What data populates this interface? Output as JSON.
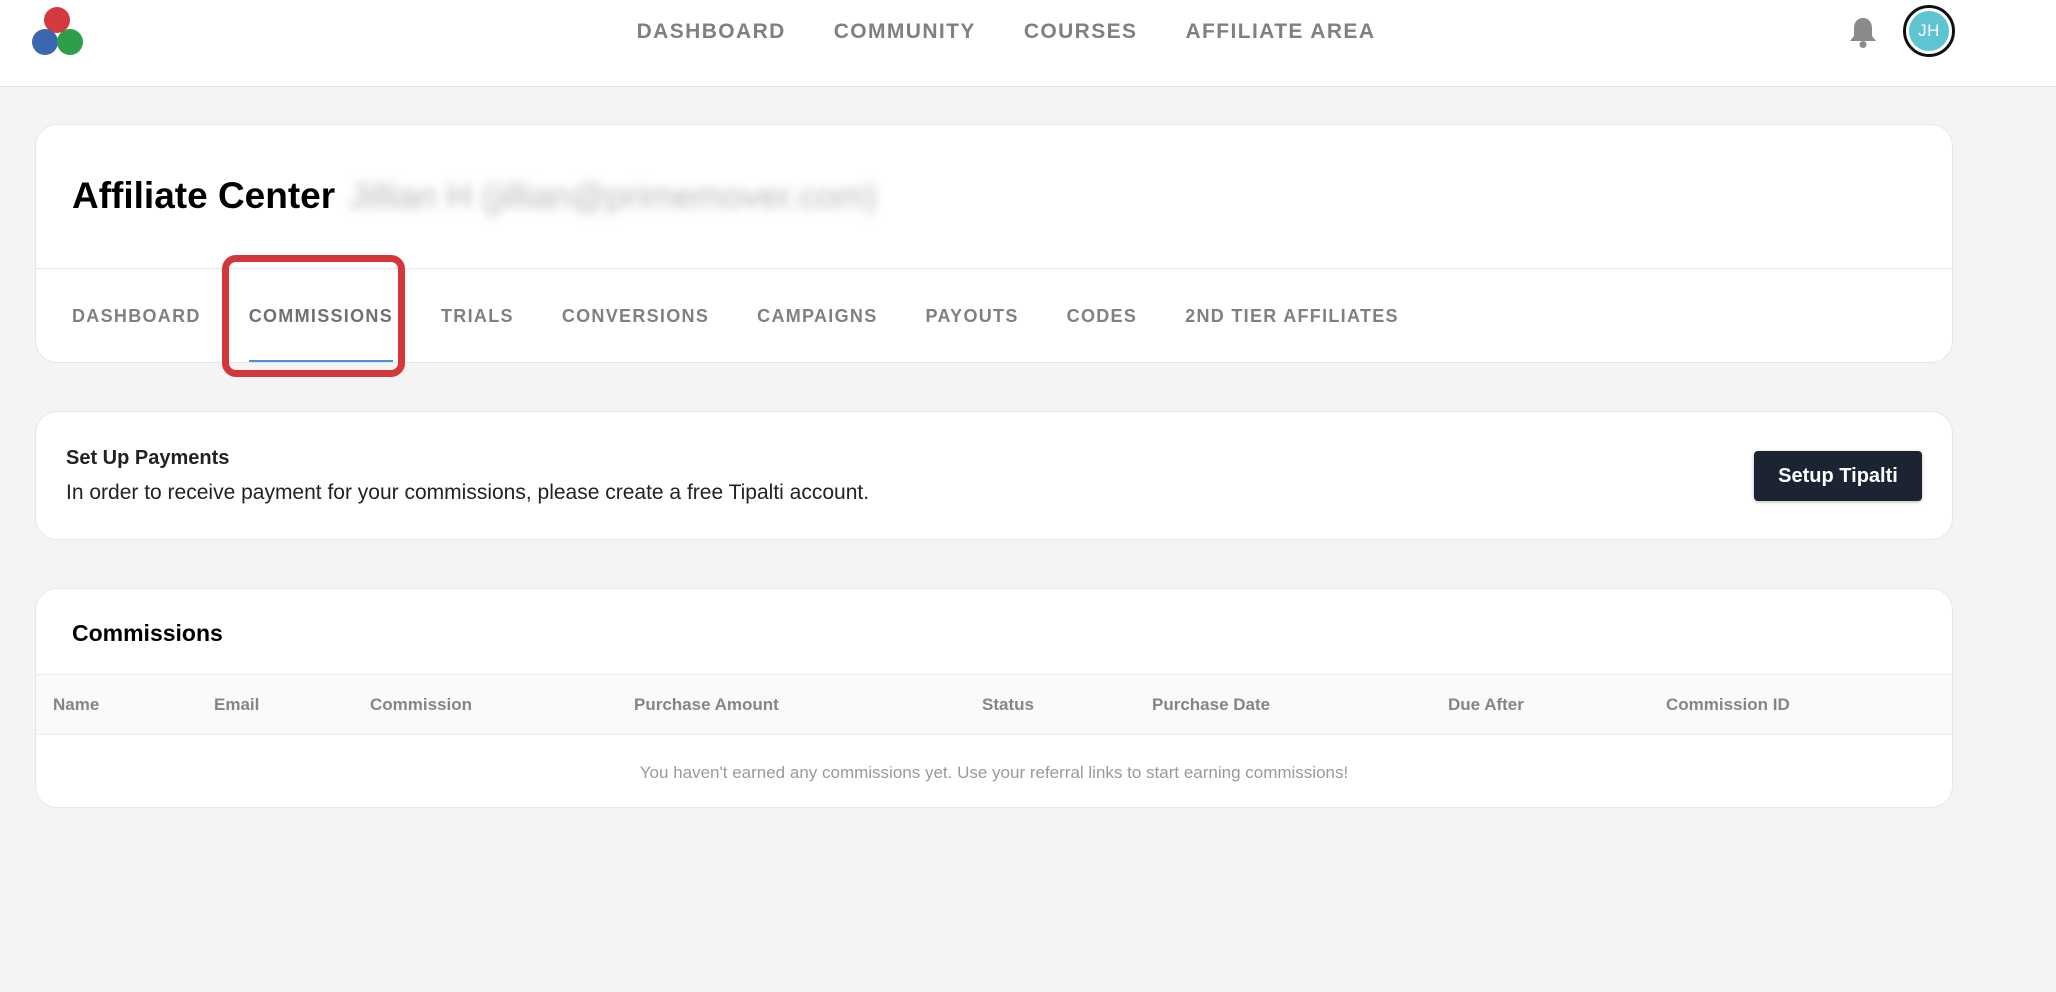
{
  "nav": {
    "items": [
      "DASHBOARD",
      "COMMUNITY",
      "COURSES",
      "AFFILIATE AREA"
    ],
    "avatar_initials": "JH"
  },
  "affiliate": {
    "title": "Affiliate Center",
    "user": "Jillian H (jillian@primemover.com)",
    "tabs": [
      "DASHBOARD",
      "COMMISSIONS",
      "TRIALS",
      "CONVERSIONS",
      "CAMPAIGNS",
      "PAYOUTS",
      "CODES",
      "2ND TIER AFFILIATES"
    ],
    "active_tab": "COMMISSIONS"
  },
  "payments": {
    "title": "Set Up Payments",
    "text": "In order to receive payment for your commissions, please create a free Tipalti account.",
    "button": "Setup Tipalti"
  },
  "commissions": {
    "title": "Commissions",
    "columns": [
      "Name",
      "Email",
      "Commission",
      "Purchase Amount",
      "Status",
      "Purchase Date",
      "Due After",
      "Commission ID"
    ],
    "empty_message": "You haven't earned any commissions yet. Use your referral links to start earning commissions!"
  },
  "colors": {
    "accent": "#4a90d9",
    "highlight": "#d3373a",
    "button_bg": "#1c2333",
    "avatar": "#5ec4d1"
  }
}
